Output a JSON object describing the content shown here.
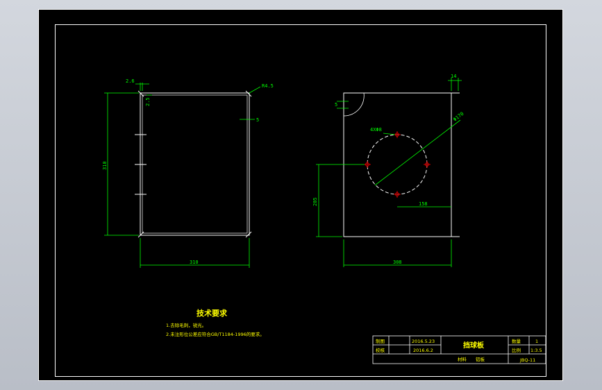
{
  "drawing": {
    "colors": {
      "background": "#000000",
      "frame": "#ffffff",
      "geometry": "#ffffff",
      "dimension": "#00ff00",
      "text_note": "#ffff00",
      "center_marks": "#ff0000",
      "title_block_text": "#ffff00"
    },
    "left_view": {
      "dims": {
        "top_small": "2.6",
        "inner_small": "2.5",
        "height": "310",
        "width": "310",
        "corner": "R4.5"
      }
    },
    "right_view": {
      "dims": {
        "top_right": "14",
        "left_side": "5",
        "holes": "4XΦ8",
        "diameter": "Φ170",
        "offset_x": "158",
        "height": "205",
        "width": "308"
      }
    },
    "notes": {
      "title": "技术要求",
      "line1": "1.去除毛刺，锐光。",
      "line2": "2.未注形位公差应符合GB/T1184-1996的要求。"
    },
    "title_block": {
      "row1_label": "制图",
      "row1_date": "2016.5.23",
      "row2_label": "校核",
      "row2_date": "2016.6.2",
      "part_name": "挡球板",
      "qty_label": "数量",
      "qty_value": "1",
      "scale_label": "比例",
      "scale_value": "1:3.5",
      "material_label": "材料",
      "material_value": "铝板",
      "drawing_no": "JBQ-11"
    }
  }
}
